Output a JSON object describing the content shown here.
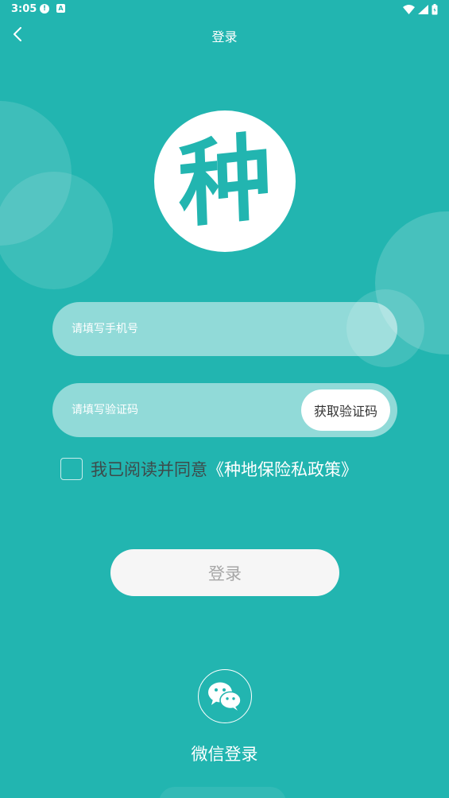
{
  "status_bar": {
    "time": "3:05",
    "icons": [
      "alert-icon",
      "a-icon",
      "wifi-icon",
      "signal-icon",
      "battery-icon"
    ]
  },
  "nav": {
    "title": "登录",
    "back_icon": "chevron-left-icon"
  },
  "logo": {
    "char": "种"
  },
  "form": {
    "phone_placeholder": "请填写手机号",
    "code_placeholder": "请填写验证码",
    "get_code_label": "获取验证码"
  },
  "agreement": {
    "text": "我已阅读并同意",
    "link": "《种地保险私政策》",
    "checked": false
  },
  "login_label": "登录",
  "wechat": {
    "icon": "wechat-icon",
    "label": "微信登录"
  },
  "colors": {
    "background": "#22b5b0",
    "field_fill": "#91dcd9",
    "button_fill": "#f6f6f6",
    "login_text": "#a7a7a7",
    "agree_text": "#3d4a4a"
  }
}
